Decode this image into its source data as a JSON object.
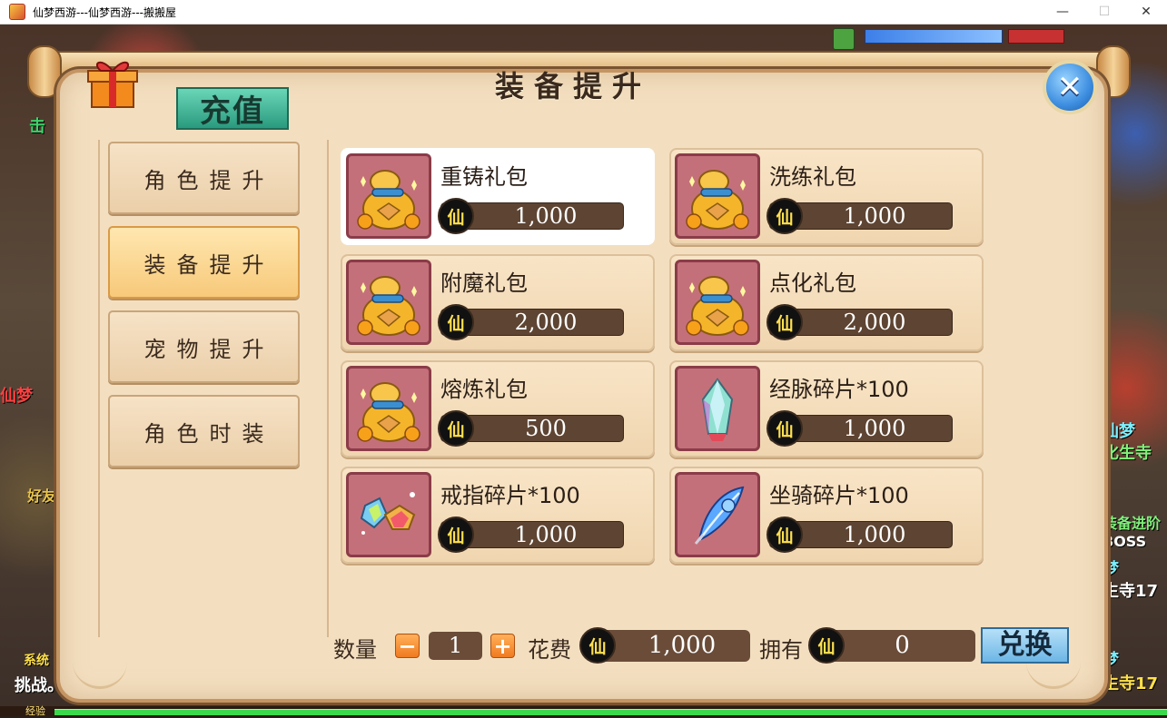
{
  "window": {
    "title": "仙梦西游---仙梦西游---搬搬屋",
    "minimize": "—",
    "maximize": "☐",
    "close": "✕"
  },
  "game_hud": {
    "exp_label": "经验",
    "side_texts": [
      "击",
      "仙梦",
      "好友",
      "系统",
      "挑战。",
      "仙梦",
      "化生寺",
      "装备进阶",
      "BOSS",
      "梦",
      "生寺17",
      "梦",
      "生寺17"
    ]
  },
  "dialog": {
    "title": "装备提升",
    "recharge_label": "充值",
    "close_icon": "close-icon",
    "currency_glyph": "仙",
    "tabs": [
      {
        "label": "角色提升",
        "active": false
      },
      {
        "label": "装备提升",
        "active": true
      },
      {
        "label": "宠物提升",
        "active": false
      },
      {
        "label": "角色时装",
        "active": false
      }
    ],
    "items": [
      {
        "name": "重铸礼包",
        "price": "1,000",
        "icon": "gold-bag-icon",
        "selected": true
      },
      {
        "name": "洗练礼包",
        "price": "1,000",
        "icon": "gold-bag-icon",
        "selected": false
      },
      {
        "name": "附魔礼包",
        "price": "2,000",
        "icon": "gold-bag-icon",
        "selected": false
      },
      {
        "name": "点化礼包",
        "price": "2,000",
        "icon": "gold-bag-icon",
        "selected": false
      },
      {
        "name": "熔炼礼包",
        "price": "500",
        "icon": "gold-bag-icon",
        "selected": false
      },
      {
        "name": "经脉碎片*100",
        "price": "1,000",
        "icon": "crystal-icon",
        "selected": false
      },
      {
        "name": "戒指碎片*100",
        "price": "1,000",
        "icon": "gems-icon",
        "selected": false
      },
      {
        "name": "坐骑碎片*100",
        "price": "1,000",
        "icon": "feather-icon",
        "selected": false
      }
    ],
    "footer": {
      "quantity_label": "数量",
      "minus": "−",
      "plus": "+",
      "quantity": "1",
      "cost_label": "花费",
      "cost": "1,000",
      "own_label": "拥有",
      "own": "0",
      "exchange_label": "兑换"
    }
  },
  "colors": {
    "dialog_bg": "#f3dfc0",
    "active_tab": "#f7c97a",
    "price_bar": "#5e4432",
    "exchange_btn": "#6db6e6",
    "recharge_btn": "#2a9a7e"
  }
}
